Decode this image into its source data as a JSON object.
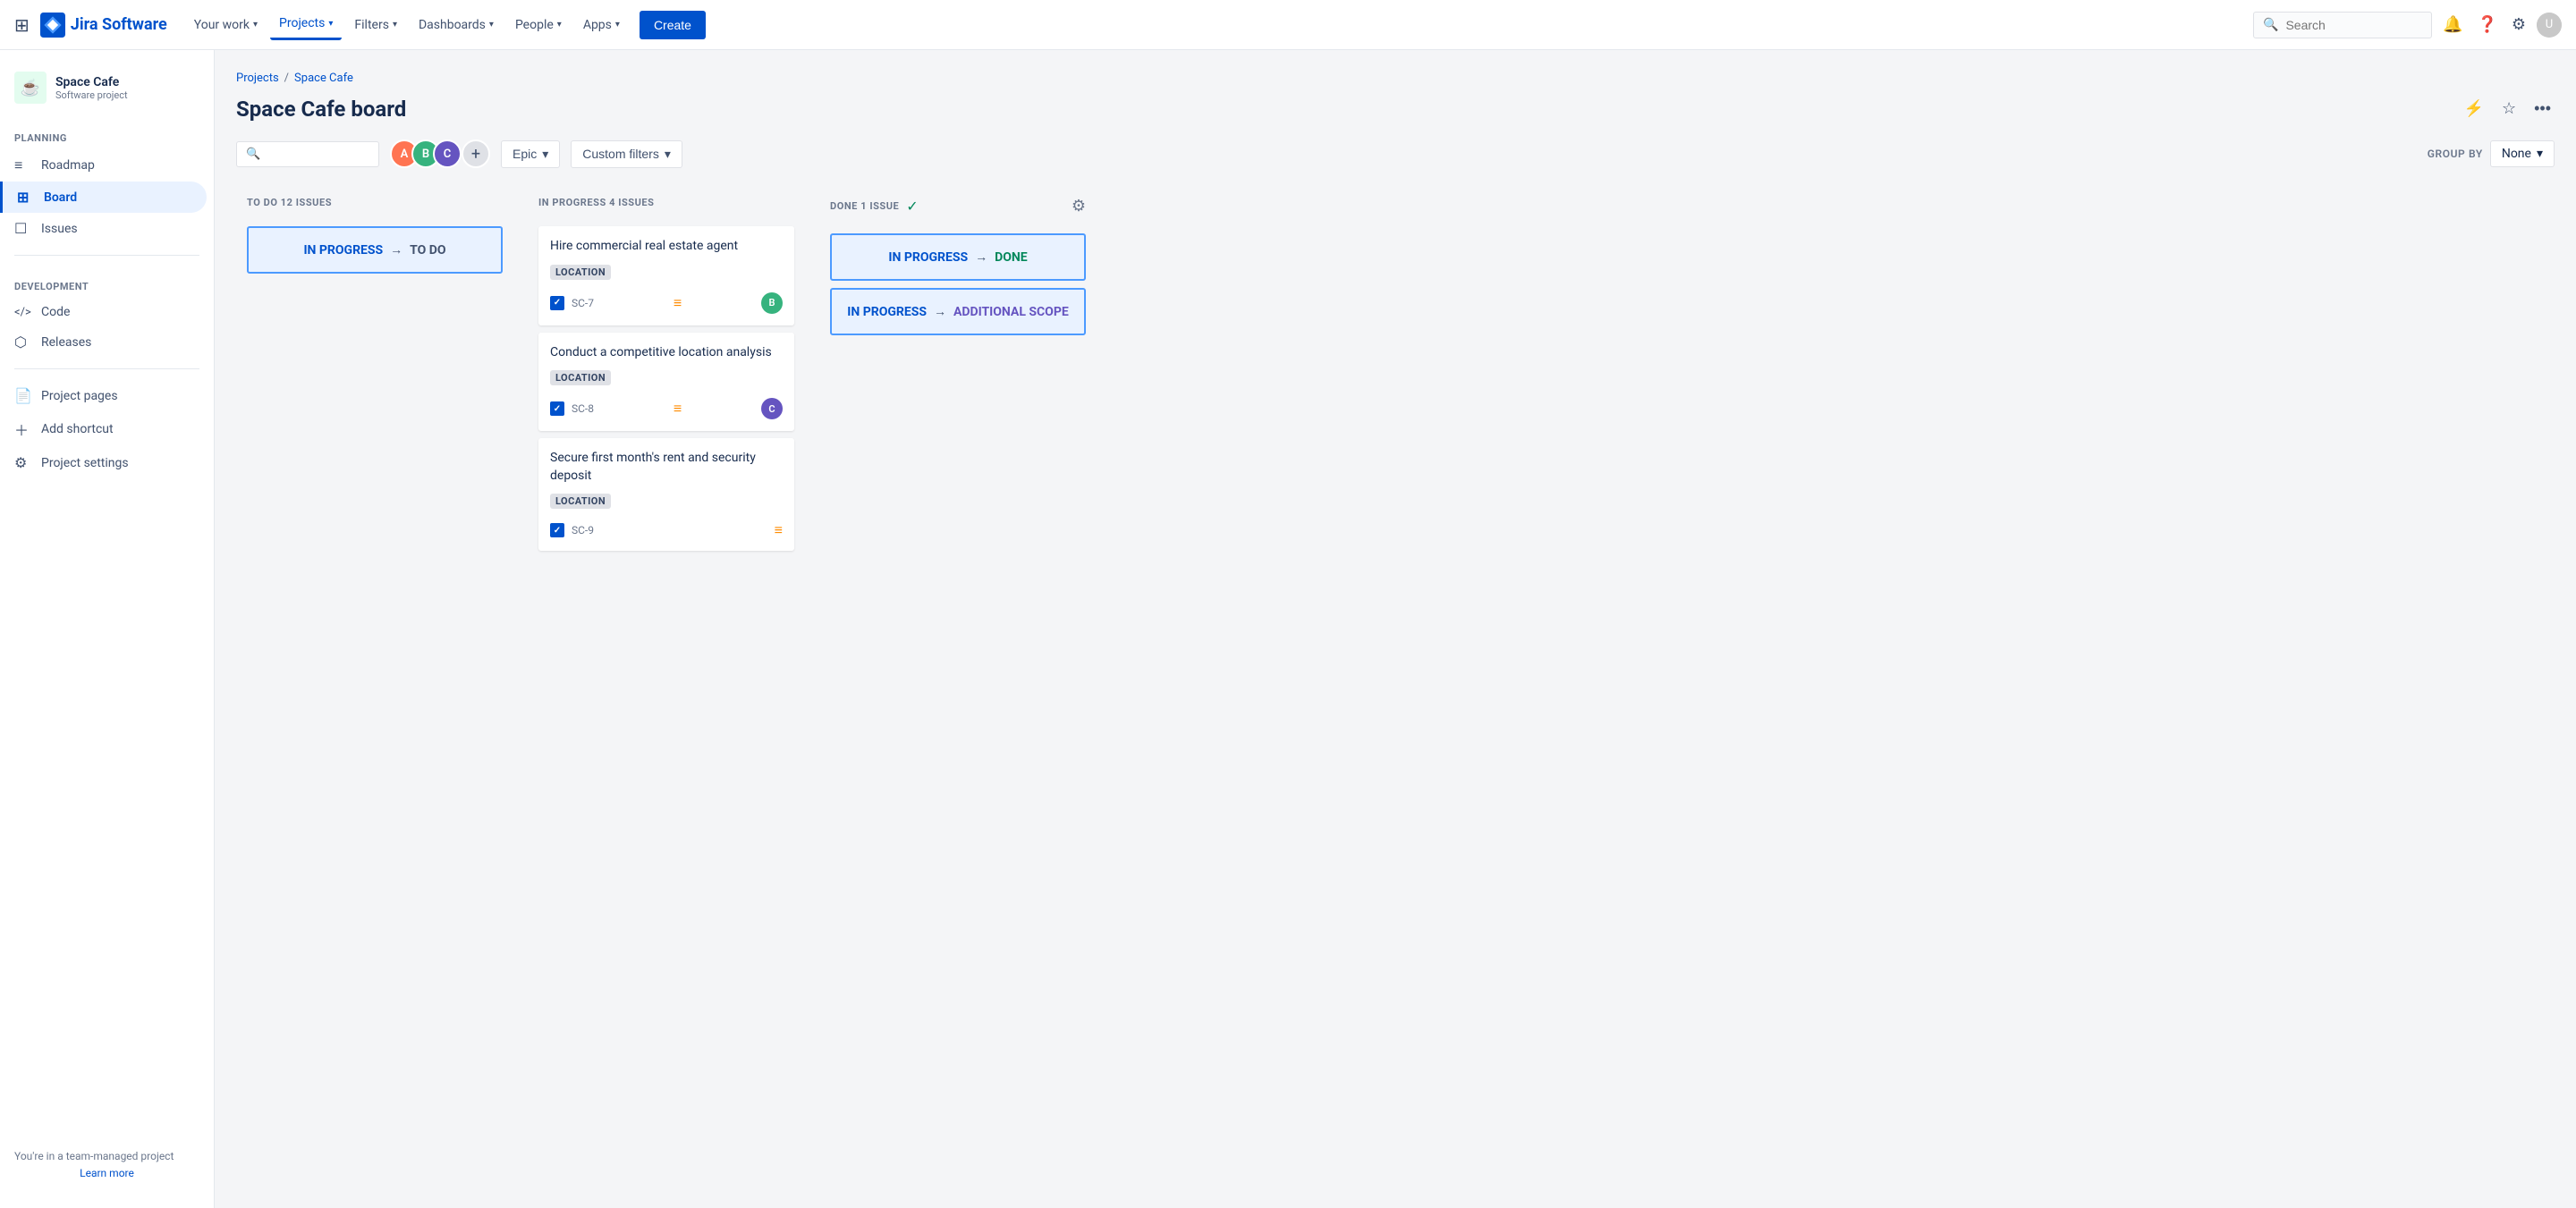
{
  "topnav": {
    "logo_text": "Jira Software",
    "links": [
      {
        "label": "Your work",
        "chevron": true,
        "active": false
      },
      {
        "label": "Projects",
        "chevron": true,
        "active": true
      },
      {
        "label": "Filters",
        "chevron": true,
        "active": false
      },
      {
        "label": "Dashboards",
        "chevron": true,
        "active": false
      },
      {
        "label": "People",
        "chevron": true,
        "active": false
      },
      {
        "label": "Apps",
        "chevron": true,
        "active": false
      }
    ],
    "create_label": "Create",
    "search_placeholder": "Search"
  },
  "sidebar": {
    "project_name": "Space Cafe",
    "project_type": "Software project",
    "planning_label": "PLANNING",
    "development_label": "DEVELOPMENT",
    "nav_items_planning": [
      {
        "label": "Roadmap",
        "icon": "≡"
      },
      {
        "label": "Board",
        "icon": "⊞",
        "active": true
      },
      {
        "label": "Issues",
        "icon": "☐"
      }
    ],
    "nav_items_development": [
      {
        "label": "Code",
        "icon": "</>"
      },
      {
        "label": "Releases",
        "icon": "⬡"
      }
    ],
    "nav_items_bottom": [
      {
        "label": "Project pages",
        "icon": "📄"
      },
      {
        "label": "Add shortcut",
        "icon": "＋"
      },
      {
        "label": "Project settings",
        "icon": "⚙"
      }
    ],
    "team_label": "You're in a team-managed project",
    "learn_more": "Learn more"
  },
  "board": {
    "breadcrumb_projects": "Projects",
    "breadcrumb_sep": "/",
    "breadcrumb_project": "Space Cafe",
    "title": "Space Cafe board",
    "filter_epic_label": "Epic",
    "filter_custom_label": "Custom filters",
    "group_by_label": "GROUP BY",
    "group_by_value": "None",
    "columns": [
      {
        "id": "todo",
        "title": "TO DO",
        "count": "12 ISSUES",
        "cards": [
          {
            "type": "transition",
            "from": "IN PROGRESS",
            "to": "TO DO"
          }
        ]
      },
      {
        "id": "inprogress",
        "title": "IN PROGRESS",
        "count": "4 ISSUES",
        "cards": [
          {
            "type": "task",
            "title": "Hire commercial real estate agent",
            "label": "LOCATION",
            "issue_id": "SC-7",
            "priority": "medium",
            "has_avatar": true,
            "avatar_color": "av2"
          },
          {
            "type": "task",
            "title": "Conduct a competitive location analysis",
            "label": "LOCATION",
            "issue_id": "SC-8",
            "priority": "medium",
            "has_avatar": true,
            "avatar_color": "av3"
          },
          {
            "type": "task",
            "title": "Secure first month's rent and security deposit",
            "label": "LOCATION",
            "issue_id": "SC-9",
            "priority": "medium",
            "has_avatar": false
          }
        ]
      },
      {
        "id": "done",
        "title": "DONE",
        "count": "1 ISSUE",
        "done": true,
        "cards": [
          {
            "type": "transition",
            "from": "IN PROGRESS",
            "to": "DONE",
            "to_style": "done"
          },
          {
            "type": "transition",
            "from": "IN PROGRESS",
            "to": "ADDITIONAL SCOPE",
            "to_style": "addl"
          }
        ]
      }
    ]
  }
}
